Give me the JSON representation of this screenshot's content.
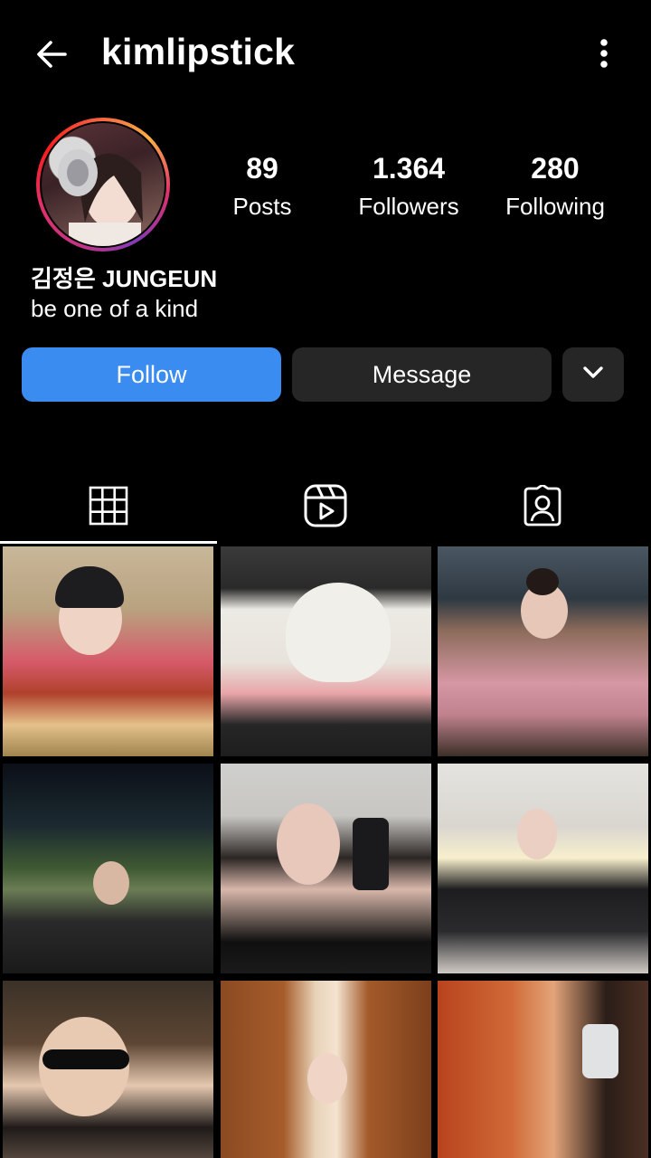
{
  "header": {
    "username": "kimlipstick",
    "back_icon": "arrow-left-icon",
    "more_icon": "more-vertical-icon"
  },
  "profile": {
    "stats": {
      "posts": {
        "value": "89",
        "label": "Posts"
      },
      "followers": {
        "value": "1.364",
        "label": "Followers"
      },
      "following": {
        "value": "280",
        "label": "Following"
      }
    },
    "name": "김정은 JUNGEUN",
    "bio": "be one of a kind",
    "avatar_ring_colors": [
      "#833ab4",
      "#e1306c",
      "#fcaf45"
    ]
  },
  "actions": {
    "follow_label": "Follow",
    "message_label": "Message",
    "more_icon": "chevron-down-icon",
    "follow_color": "#3b8cf0",
    "secondary_color": "#262626"
  },
  "tabs": [
    {
      "name": "posts",
      "icon": "grid-icon",
      "active": true
    },
    {
      "name": "reels",
      "icon": "reels-icon",
      "active": false
    },
    {
      "name": "tagged",
      "icon": "tagged-person-icon",
      "active": false
    }
  ],
  "grid": {
    "post_count_visible": 9
  }
}
